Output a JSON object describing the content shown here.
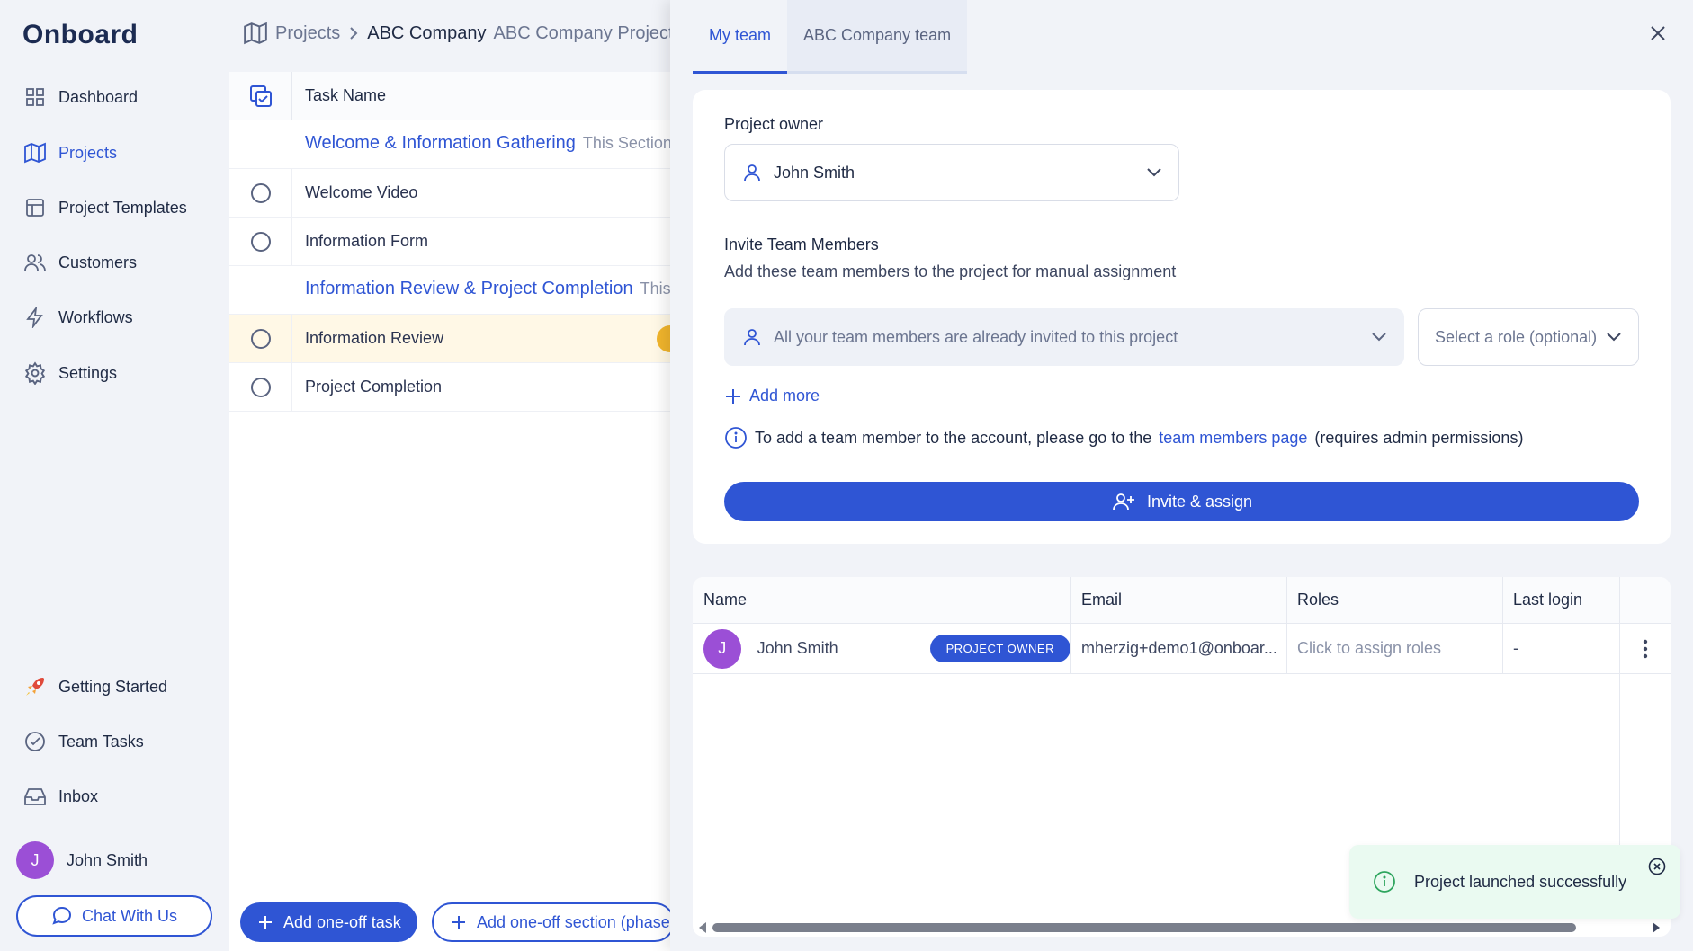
{
  "app": {
    "logo": "Onboard"
  },
  "sidebar": {
    "items": [
      {
        "label": "Dashboard",
        "icon": "grid-icon"
      },
      {
        "label": "Projects",
        "icon": "map-icon"
      },
      {
        "label": "Project Templates",
        "icon": "template-icon"
      },
      {
        "label": "Customers",
        "icon": "users-icon"
      },
      {
        "label": "Workflows",
        "icon": "bolt-icon"
      },
      {
        "label": "Settings",
        "icon": "gear-icon"
      }
    ],
    "bottom_items": [
      {
        "label": "Getting Started",
        "icon": "rocket-icon"
      },
      {
        "label": "Team Tasks",
        "icon": "check-circle-icon"
      },
      {
        "label": "Inbox",
        "icon": "inbox-icon"
      }
    ],
    "user": {
      "initial": "J",
      "name": "John Smith"
    },
    "chat": "Chat With Us"
  },
  "breadcrumb": {
    "root": "Projects",
    "company": "ABC Company",
    "project": "ABC Company Project"
  },
  "tasks": {
    "header": "Task Name",
    "rows": [
      {
        "type": "section",
        "label": "Welcome & Information Gathering",
        "sub": "This Section"
      },
      {
        "type": "task",
        "label": "Welcome Video"
      },
      {
        "type": "task",
        "label": "Information Form"
      },
      {
        "type": "section",
        "label": "Information Review & Project Completion",
        "sub": "This"
      },
      {
        "type": "task",
        "label": "Information Review"
      },
      {
        "type": "task",
        "label": "Project Completion"
      }
    ],
    "add_task": "Add one-off task",
    "add_section": "Add one-off section (phase)"
  },
  "panel": {
    "tabs": [
      "My team",
      "ABC Company team"
    ],
    "owner_label": "Project owner",
    "owner_value": "John Smith",
    "invite_title": "Invite Team Members",
    "invite_desc": "Add these team members to the project for manual assignment",
    "members_placeholder": "All your team members are already invited to this project",
    "role_placeholder": "Select a role (optional)",
    "add_more": "Add more",
    "info_prefix": "To add a team member to the account, please go to the",
    "info_link": "team members page",
    "info_suffix": "(requires admin permissions)",
    "invite_button": "Invite & assign"
  },
  "team_table": {
    "headers": [
      "Name",
      "Email",
      "Roles",
      "Last login"
    ],
    "rows": [
      {
        "initial": "J",
        "name": "John Smith",
        "badge": "PROJECT OWNER",
        "email": "mherzig+demo1@onboar...",
        "roles": "Click to assign roles",
        "last_login": "-"
      }
    ]
  },
  "toast": {
    "message": "Project launched successfully"
  },
  "colors": {
    "accent": "#2f55d4",
    "avatar": "#9b4fd6",
    "highlight": "#fff8e6",
    "toast_bg": "#eafaf1"
  }
}
